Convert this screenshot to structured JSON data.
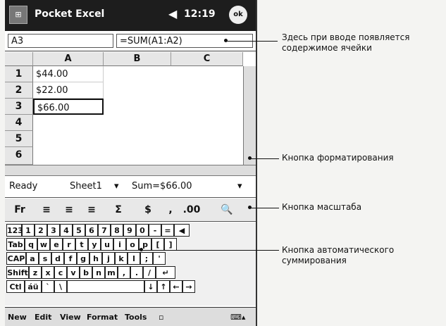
{
  "titlebar": {
    "app_title": "Pocket Excel",
    "clock": "12:19",
    "ok_label": "ok"
  },
  "formula_bar": {
    "cell_ref": "A3",
    "formula": "=SUM(A1:A2)"
  },
  "sheet": {
    "columns": [
      "A",
      "B",
      "C"
    ],
    "rows": [
      "1",
      "2",
      "3",
      "4",
      "5",
      "6"
    ],
    "cells": {
      "A1": "$44.00",
      "A2": "$22.00",
      "A3": "$66.00"
    }
  },
  "status": {
    "ready": "Ready",
    "sheet": "Sheet1",
    "sum": "Sum=$66.00"
  },
  "toolbar": {
    "format_label": "Fr",
    "sum_label": "Σ",
    "comma_label": ",",
    "decimals_label": ".00"
  },
  "keyboard": {
    "row1": [
      "123",
      "1",
      "2",
      "3",
      "4",
      "5",
      "6",
      "7",
      "8",
      "9",
      "0",
      "-",
      "="
    ],
    "row2": [
      "Tab",
      "q",
      "w",
      "e",
      "r",
      "t",
      "y",
      "u",
      "i",
      "o",
      "p",
      "[",
      "]"
    ],
    "row3": [
      "CAP",
      "a",
      "s",
      "d",
      "f",
      "g",
      "h",
      "j",
      "k",
      "l",
      ";",
      "'"
    ],
    "row4": [
      "Shift",
      "z",
      "x",
      "c",
      "v",
      "b",
      "n",
      "m",
      ",",
      ".",
      "/"
    ],
    "row5": [
      "Ctl",
      "áü",
      "`",
      "\\"
    ]
  },
  "menubar": {
    "items": [
      "New",
      "Edit",
      "View",
      "Format",
      "Tools"
    ]
  },
  "annotations": {
    "cell_content": "Здесь при вводе появляется содержимое ячейки",
    "format_button": "Кнопка форматирования",
    "zoom_button": "Кнопка масштаба",
    "autosum_button": "Кнопка автоматического суммирования"
  }
}
